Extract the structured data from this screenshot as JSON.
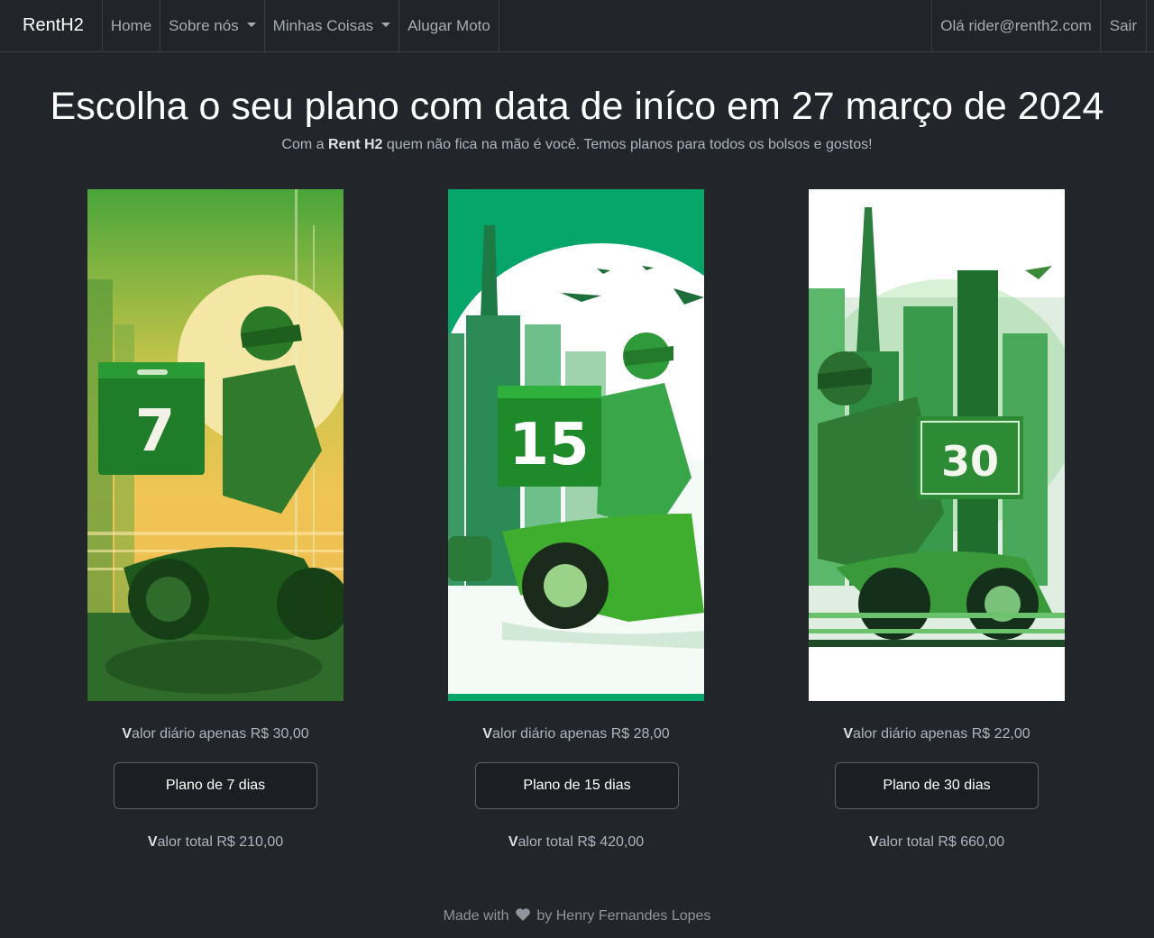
{
  "nav": {
    "brand": "RentH2",
    "home": "Home",
    "about": "Sobre nós",
    "my_stuff": "Minhas Coisas",
    "rent": "Alugar Moto",
    "greeting": "Olá rider@renth2.com",
    "logout": "Sair"
  },
  "header": {
    "title": "Escolha o seu plano com data de iníco em 27 março de 2024",
    "sub_before": "Com a ",
    "sub_brand": "Rent H2",
    "sub_after": " quem não fica na mão é você. Temos planos para todos os bolsos e gostos!"
  },
  "plans": [
    {
      "badge": "7",
      "daily_first": "V",
      "daily_rest": "alor diário apenas R$ 30,00",
      "button": "Plano de 7 dias",
      "total_first": "V",
      "total_rest": "alor total R$ 210,00"
    },
    {
      "badge": "15",
      "daily_first": "V",
      "daily_rest": "alor diário apenas R$ 28,00",
      "button": "Plano de 15 dias",
      "total_first": "V",
      "total_rest": "alor total R$ 420,00"
    },
    {
      "badge": "30",
      "daily_first": "V",
      "daily_rest": "alor diário apenas R$ 22,00",
      "button": "Plano de 30 dias",
      "total_first": "V",
      "total_rest": "alor total R$ 660,00"
    }
  ],
  "footer": {
    "before": "Made with",
    "after": "by Henry Fernandes Lopes"
  },
  "colors": {
    "background": "#222529",
    "navbar": "#212529",
    "accent_green": "#2e9e3a"
  }
}
